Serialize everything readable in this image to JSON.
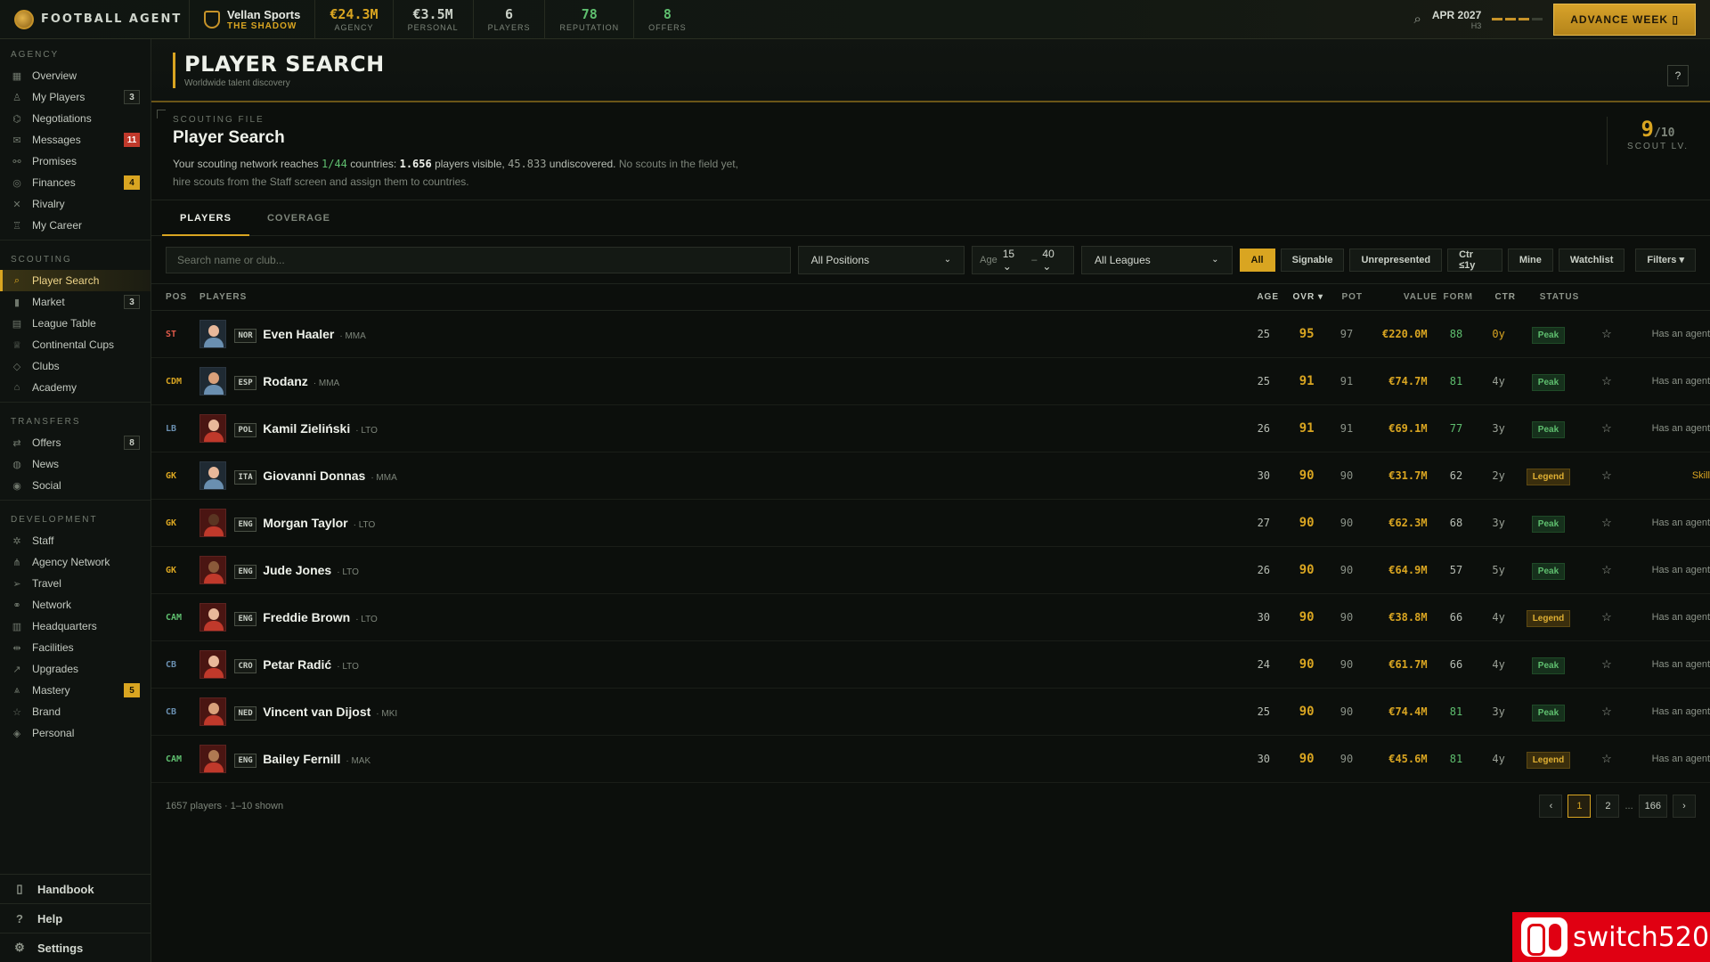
{
  "app": {
    "brand": "FOOTBALL AGENT"
  },
  "club": {
    "name": "Vellan Sports",
    "subtitle": "THE SHADOW"
  },
  "stats": [
    {
      "value": "€24.3M",
      "label": "AGENCY",
      "color": "#d9a521"
    },
    {
      "value": "€3.5M",
      "label": "PERSONAL",
      "color": "#c9cfc6"
    },
    {
      "value": "6",
      "label": "PLAYERS",
      "color": "#c9cfc6"
    },
    {
      "value": "78",
      "label": "REPUTATION",
      "color": "#5fbf6f"
    },
    {
      "value": "8",
      "label": "OFFERS",
      "color": "#5fbf6f"
    }
  ],
  "date": {
    "month": "APR 2027",
    "half": "H3",
    "weeks_done": 3,
    "weeks_total": 4
  },
  "advance_label": "ADVANCE WEEK",
  "sidebar": {
    "sections": [
      {
        "title": "AGENCY",
        "items": [
          {
            "label": "Overview",
            "icon": "grid-icon",
            "glyph": "▦"
          },
          {
            "label": "My Players",
            "icon": "user-icon",
            "glyph": "♙",
            "badge": "3"
          },
          {
            "label": "Negotiations",
            "icon": "handshake-icon",
            "glyph": "⌬"
          },
          {
            "label": "Messages",
            "icon": "mail-icon",
            "glyph": "✉",
            "badge": "11",
            "badge_style": "red"
          },
          {
            "label": "Promises",
            "icon": "link-icon",
            "glyph": "⚯"
          },
          {
            "label": "Finances",
            "icon": "coin-icon",
            "glyph": "◎",
            "badge": "4",
            "badge_style": "gold"
          },
          {
            "label": "Rivalry",
            "icon": "swords-icon",
            "glyph": "✕"
          },
          {
            "label": "My Career",
            "icon": "medal-icon",
            "glyph": "♖"
          }
        ]
      },
      {
        "title": "SCOUTING",
        "items": [
          {
            "label": "Player Search",
            "icon": "search-icon",
            "glyph": "⌕",
            "active": true
          },
          {
            "label": "Market",
            "icon": "bar-chart-icon",
            "glyph": "▮",
            "badge": "3"
          },
          {
            "label": "League Table",
            "icon": "table-icon",
            "glyph": "▤"
          },
          {
            "label": "Continental Cups",
            "icon": "trophy-icon",
            "glyph": "♕"
          },
          {
            "label": "Clubs",
            "icon": "shield-icon",
            "glyph": "◇"
          },
          {
            "label": "Academy",
            "icon": "graduation-icon",
            "glyph": "⌂"
          }
        ]
      },
      {
        "title": "TRANSFERS",
        "items": [
          {
            "label": "Offers",
            "icon": "transfer-icon",
            "glyph": "⇄",
            "badge": "8"
          },
          {
            "label": "News",
            "icon": "globe-icon",
            "glyph": "◍"
          },
          {
            "label": "Social",
            "icon": "broadcast-icon",
            "glyph": "◉"
          }
        ]
      },
      {
        "title": "DEVELOPMENT",
        "items": [
          {
            "label": "Staff",
            "icon": "staff-icon",
            "glyph": "✲"
          },
          {
            "label": "Agency Network",
            "icon": "network-icon",
            "glyph": "⋔"
          },
          {
            "label": "Travel",
            "icon": "plane-icon",
            "glyph": "➢"
          },
          {
            "label": "Network",
            "icon": "chain-icon",
            "glyph": "⚭"
          },
          {
            "label": "Headquarters",
            "icon": "building-icon",
            "glyph": "▥"
          },
          {
            "label": "Facilities",
            "icon": "dumbbell-icon",
            "glyph": "⇹"
          },
          {
            "label": "Upgrades",
            "icon": "trend-icon",
            "glyph": "↗"
          },
          {
            "label": "Mastery",
            "icon": "mastery-icon",
            "glyph": "⩓",
            "badge": "5",
            "badge_style": "gold"
          },
          {
            "label": "Brand",
            "icon": "star-icon",
            "glyph": "☆"
          },
          {
            "label": "Personal",
            "icon": "gem-icon",
            "glyph": "◈"
          }
        ]
      }
    ],
    "bottom": [
      {
        "label": "Handbook",
        "icon": "book-icon",
        "glyph": "▯"
      },
      {
        "label": "Help",
        "icon": "help-icon",
        "glyph": "?"
      },
      {
        "label": "Settings",
        "icon": "gear-icon",
        "glyph": "⚙"
      }
    ]
  },
  "page": {
    "title": "PLAYER SEARCH",
    "subtitle": "Worldwide talent discovery",
    "help": "?"
  },
  "scouting": {
    "label": "SCOUTING FILE",
    "title": "Player Search",
    "t1": "Your scouting network reaches ",
    "reach": "1/44",
    "t2": " countries: ",
    "visible": "1.656",
    "t3": " players visible, ",
    "undiscovered": "45.833",
    "t4": " undiscovered.",
    "t5": " No scouts in the field yet, hire scouts from the Staff screen and assign them to countries.",
    "level": "9",
    "level_max": "/10",
    "level_label": "SCOUT LV."
  },
  "tabs": [
    "PLAYERS",
    "COVERAGE"
  ],
  "filters": {
    "search_placeholder": "Search name or club...",
    "position": "All Positions",
    "age_label": "Age",
    "age_min": "15",
    "age_sep": "–",
    "age_max": "40",
    "league": "All Leagues",
    "chips": [
      "All",
      "Signable",
      "Unrepresented",
      "Ctr ≤1y",
      "Mine",
      "Watchlist"
    ],
    "more": "Filters"
  },
  "columns": {
    "pos": "POS",
    "players": "PLAYERS",
    "age": "AGE",
    "ovr": "OVR ▾",
    "pot": "POT",
    "value": "VALUE",
    "form": "FORM",
    "ctr": "CTR",
    "status": "STATUS"
  },
  "players": [
    {
      "pos": "ST",
      "pos_color": "#e05a4a",
      "nat": "NOR",
      "name": "Even Haaler",
      "club": "· MMA",
      "age": "25",
      "ovr": "95",
      "pot": "97",
      "value": "€220.0M",
      "form": "88",
      "form_color": "#5fbf6f",
      "ctr": "0y",
      "ctr_color": "#d9a521",
      "status": "Peak",
      "agent": "Has an agent",
      "avatar": "blue",
      "skin": "#e8b89a",
      "shirt": "#6a8fb0"
    },
    {
      "pos": "CDM",
      "pos_color": "#d9a521",
      "nat": "ESP",
      "name": "Rodanz",
      "club": "· MMA",
      "age": "25",
      "ovr": "91",
      "pot": "91",
      "value": "€74.7M",
      "form": "81",
      "form_color": "#5fbf6f",
      "ctr": "4y",
      "ctr_color": "#9aa096",
      "status": "Peak",
      "agent": "Has an agent",
      "avatar": "blue",
      "skin": "#d9a07a",
      "shirt": "#6a8fb0"
    },
    {
      "pos": "LB",
      "pos_color": "#6a8fb0",
      "nat": "POL",
      "name": "Kamil Zieliński",
      "club": "· LTO",
      "age": "26",
      "ovr": "91",
      "pot": "91",
      "value": "€69.1M",
      "form": "77",
      "form_color": "#5fbf6f",
      "ctr": "3y",
      "ctr_color": "#9aa096",
      "status": "Peak",
      "agent": "Has an agent",
      "avatar": "red",
      "skin": "#e8b89a",
      "shirt": "#c0392b"
    },
    {
      "pos": "GK",
      "pos_color": "#d9a521",
      "nat": "ITA",
      "name": "Giovanni Donnas",
      "club": "· MMA",
      "age": "30",
      "ovr": "90",
      "pot": "90",
      "value": "€31.7M",
      "form": "62",
      "form_color": "#b7bdb4",
      "ctr": "2y",
      "ctr_color": "#9aa096",
      "status": "Legend",
      "agent": "Skill",
      "agent_color": "#d9a521",
      "avatar": "blue",
      "skin": "#e8b89a",
      "shirt": "#6a8fb0"
    },
    {
      "pos": "GK",
      "pos_color": "#d9a521",
      "nat": "ENG",
      "name": "Morgan Taylor",
      "club": "· LTO",
      "age": "27",
      "ovr": "90",
      "pot": "90",
      "value": "€62.3M",
      "form": "68",
      "form_color": "#b7bdb4",
      "ctr": "3y",
      "ctr_color": "#9aa096",
      "status": "Peak",
      "agent": "Has an agent",
      "avatar": "red",
      "skin": "#5a3522",
      "shirt": "#c0392b"
    },
    {
      "pos": "GK",
      "pos_color": "#d9a521",
      "nat": "ENG",
      "name": "Jude Jones",
      "club": "· LTO",
      "age": "26",
      "ovr": "90",
      "pot": "90",
      "value": "€64.9M",
      "form": "57",
      "form_color": "#b7bdb4",
      "ctr": "5y",
      "ctr_color": "#9aa096",
      "status": "Peak",
      "agent": "Has an agent",
      "avatar": "red",
      "skin": "#8a5a3a",
      "shirt": "#c0392b"
    },
    {
      "pos": "CAM",
      "pos_color": "#5fbf6f",
      "nat": "ENG",
      "name": "Freddie Brown",
      "club": "· LTO",
      "age": "30",
      "ovr": "90",
      "pot": "90",
      "value": "€38.8M",
      "form": "66",
      "form_color": "#b7bdb4",
      "ctr": "4y",
      "ctr_color": "#9aa096",
      "status": "Legend",
      "agent": "Has an agent",
      "avatar": "red",
      "skin": "#e8b89a",
      "shirt": "#c0392b"
    },
    {
      "pos": "CB",
      "pos_color": "#6a8fb0",
      "nat": "CRO",
      "name": "Petar Radić",
      "club": "· LTO",
      "age": "24",
      "ovr": "90",
      "pot": "90",
      "value": "€61.7M",
      "form": "66",
      "form_color": "#b7bdb4",
      "ctr": "4y",
      "ctr_color": "#9aa096",
      "status": "Peak",
      "agent": "Has an agent",
      "avatar": "red",
      "skin": "#e8b89a",
      "shirt": "#c0392b"
    },
    {
      "pos": "CB",
      "pos_color": "#6a8fb0",
      "nat": "NED",
      "name": "Vincent van Dijost",
      "club": "· MKI",
      "age": "25",
      "ovr": "90",
      "pot": "90",
      "value": "€74.4M",
      "form": "81",
      "form_color": "#5fbf6f",
      "ctr": "3y",
      "ctr_color": "#9aa096",
      "status": "Peak",
      "agent": "Has an agent",
      "avatar": "red",
      "skin": "#d9a07a",
      "shirt": "#c0392b"
    },
    {
      "pos": "CAM",
      "pos_color": "#5fbf6f",
      "nat": "ENG",
      "name": "Bailey Fernill",
      "club": "· MAK",
      "age": "30",
      "ovr": "90",
      "pot": "90",
      "value": "€45.6M",
      "form": "81",
      "form_color": "#5fbf6f",
      "ctr": "4y",
      "ctr_color": "#9aa096",
      "status": "Legend",
      "agent": "Has an agent",
      "avatar": "red",
      "skin": "#b07a52",
      "shirt": "#c0392b"
    }
  ],
  "footer": {
    "count": "1657 players · 1–10 shown",
    "prev": "‹",
    "pages": [
      "1",
      "2"
    ],
    "dots": "...",
    "last": "166",
    "next": "›"
  },
  "watermark": "switch520"
}
